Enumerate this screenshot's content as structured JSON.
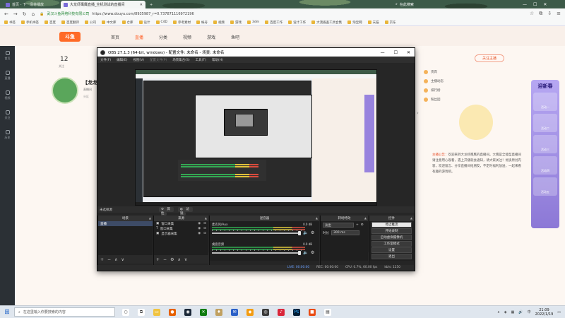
{
  "browser": {
    "tabs": [
      {
        "label": "首页 - 下一场将播放",
        "active": false
      },
      {
        "label": "大龙虾鹰鹰直播_全机测试的直播间",
        "active": true
      }
    ],
    "new_tab": "+",
    "search_label": "在此搜索",
    "window_controls": [
      "—",
      "☐",
      "✕"
    ],
    "site_name": "武汉斗鱼网络科技有限公司",
    "url": "https://www.douyu.com/8935987_r=0.737871116972196",
    "bookmarks": [
      "书签",
      "手机书签",
      "百度",
      "百度翻译",
      "公司",
      "中文库",
      "仓库",
      "设计",
      "C4D",
      "参考素材",
      "帐号",
      "视频",
      "游戏",
      "3dm",
      "百度工作",
      "设计工作",
      "大漠盾查工具合集",
      "淘宝网",
      "天猫",
      "京东"
    ]
  },
  "douyu": {
    "logo": "斗鱼",
    "menu": [
      "首页",
      "直播",
      "分类",
      "视频",
      "游戏",
      "鱼吧"
    ],
    "menu_active_index": 1,
    "follow_button": "关注主播",
    "viewer_count": "12",
    "viewer_label": "关注",
    "room_title": "【龙龙",
    "room_sub": "直播间",
    "room_sub2": "分区",
    "panel_rows": [
      "贵宾",
      "主播动态",
      "排行榜",
      "粉丝团"
    ],
    "note_key": "主播公告：",
    "note_text": "欢迎来到大龙虾鹰鹰的直播间。大鹰是全能型直播间请注意用心观看，遇上开播就会通知，请大家关注！优质原创内容，欢迎留言、分享直播间给朋友，不定时福利放送，一起来看有趣的游戏吧。",
    "rightbar_title": "迎新春",
    "rightbar_items": [
      "活动一",
      "活动二",
      "活动三",
      "活动四",
      "活动五"
    ],
    "sidebar_items": [
      "首页",
      "直播",
      "视频",
      "关注",
      "历史"
    ]
  },
  "obs": {
    "title": "OBS 27.1.3 (64-bit, windows) - 配置文件: 未命名 - 场景: 未命名",
    "menu": [
      "文件(F)",
      "编辑(E)",
      "视图(V)",
      "配置文件(P)",
      "场景集合(S)",
      "工具(T)",
      "帮助(H)"
    ],
    "no_source_label": "未选择源",
    "props_button": "属性",
    "filters_button": "滤镜",
    "docks": {
      "scenes": "场景",
      "sources": "来源",
      "mixer": "混音器",
      "transitions": "转场特效",
      "controls": "控件"
    },
    "scenes_list": [
      "直播"
    ],
    "sources_list": [
      {
        "icon": "▣",
        "name": "窗口采集"
      },
      {
        "icon": "T",
        "name": "窗口采集"
      },
      {
        "icon": "▣",
        "name": "显示器采集"
      }
    ],
    "mixer_channels": [
      {
        "name": "麦克风/Aux",
        "db": "0.0 dB"
      },
      {
        "name": "桌面音频",
        "db": "0.0 dB"
      }
    ],
    "transition": {
      "type": "淡出",
      "duration_label": "时长",
      "duration": "300 ms"
    },
    "controls": [
      "停止推流",
      "开始录制",
      "启动虚拟摄像机",
      "工作室模式",
      "设置",
      "退出"
    ],
    "status": {
      "live": "LIVE: 00:00:00",
      "rec": "REC: 00:00:00",
      "cpu": "CPU: 0.7%, 60.00 fps",
      "kbps": "kb/s: 1250"
    }
  },
  "taskbar": {
    "search_placeholder": "在这里输入你要搜索的内容",
    "time": "21:09",
    "date": "2022/1/19",
    "lang": "中"
  }
}
